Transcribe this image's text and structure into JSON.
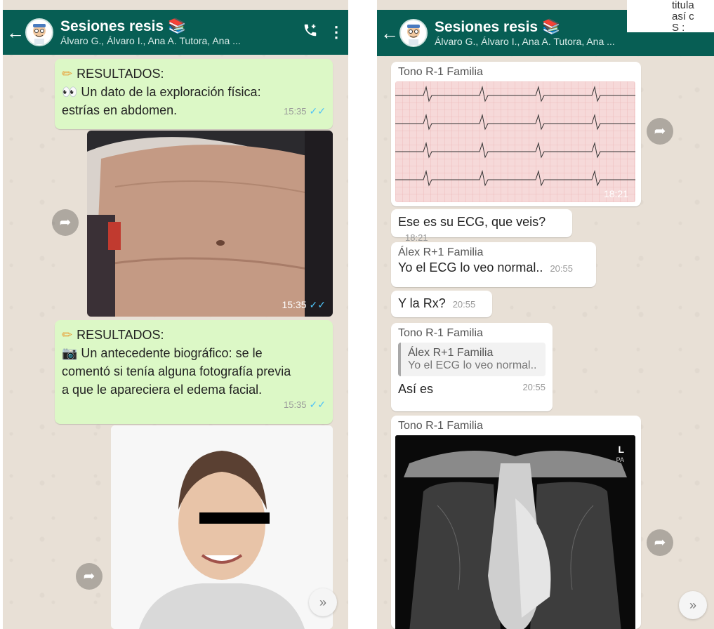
{
  "chat": {
    "title": "Sesiones resis",
    "title_icon": "books-emoji",
    "subtitle": "Álvaro G., Álvaro I., Ana A. Tutora, Ana ...",
    "back": "←",
    "call_icon": "📞",
    "menu_icon": "⋮"
  },
  "corner": {
    "line1": "titula",
    "line2": "así c",
    "line3": "S :"
  },
  "left": {
    "msg1": {
      "header": "RESULTADOS:",
      "text1": "Un dato de la exploración física:",
      "text2": "estrías en abdomen.",
      "time": "15:35"
    },
    "photo1": {
      "time": "15:35"
    },
    "msg2": {
      "header": "RESULTADOS:",
      "text1": "Un antecedente biográfico: se le",
      "text2": "comentó si tenía alguna fotografía previa",
      "text3": "a que le apareciera el edema facial.",
      "time": "15:35"
    },
    "ticks": "✓✓"
  },
  "right": {
    "ecg_sender": "Tono R-1 Familia",
    "ecg_time": "18:21",
    "m1": {
      "text": "Ese es su ECG, que veis?",
      "time": "18:21"
    },
    "m2": {
      "sender": "Álex R+1 Familia",
      "text": "Yo el ECG lo veo normal..",
      "time": "20:55"
    },
    "m3": {
      "text": "Y la Rx?",
      "time": "20:55"
    },
    "m4": {
      "sender": "Tono R-1 Familia",
      "quote_sender": "Álex R+1 Familia",
      "quote_text": "Yo el ECG lo veo normal..",
      "text": "Así es",
      "time": "20:55"
    },
    "xray_sender": "Tono R-1 Familia",
    "xray_label": "L",
    "xray_sub": "PA"
  },
  "icons": {
    "forward": "➦",
    "scroll_down": "»"
  },
  "colors": {
    "header": "#075e54",
    "outgoing": "#dcf8c6",
    "incoming": "#ffffff",
    "tick": "#4fc3f7"
  }
}
